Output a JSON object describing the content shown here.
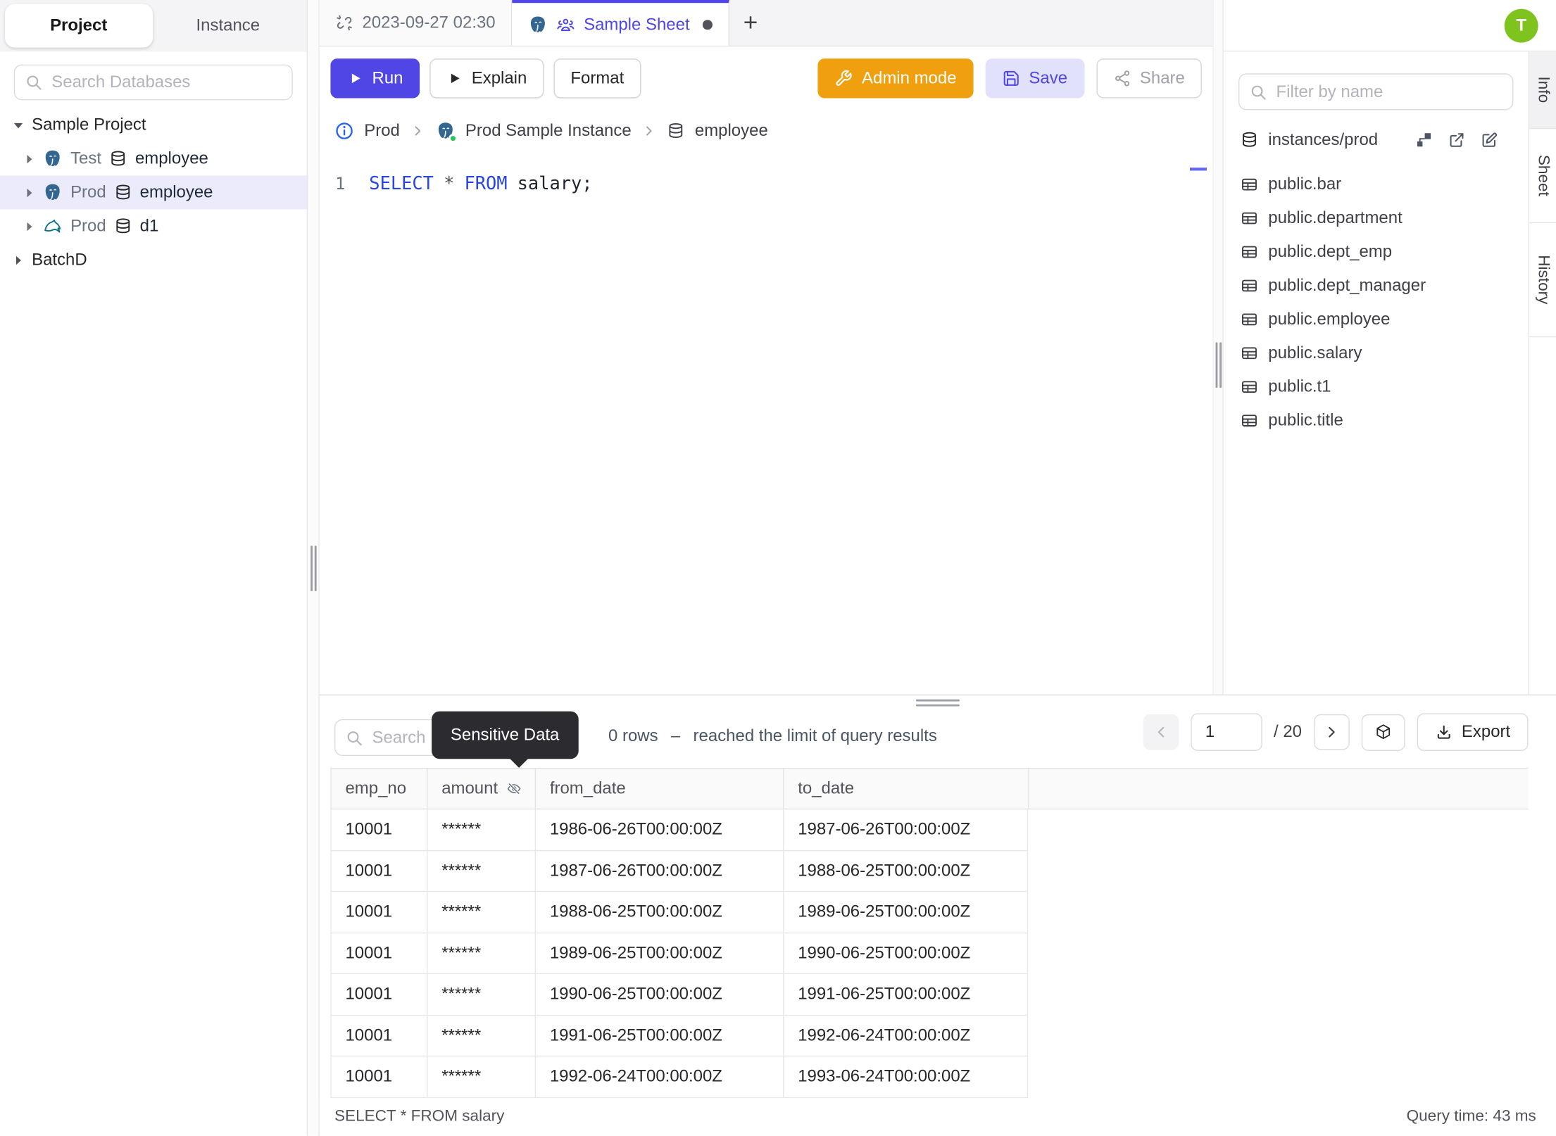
{
  "sidebar": {
    "tabs": {
      "project": "Project",
      "instance": "Instance"
    },
    "search_placeholder": "Search Databases",
    "tree": {
      "project_label": "Sample Project",
      "items": [
        {
          "env": "Test",
          "db": "employee",
          "engine": "postgres"
        },
        {
          "env": "Prod",
          "db": "employee",
          "engine": "postgres",
          "selected": true
        },
        {
          "env": "Prod",
          "db": "d1",
          "engine": "mysql"
        }
      ],
      "batch_label": "BatchD"
    }
  },
  "tabbar": {
    "tab1": "2023-09-27 02:30",
    "tab2": "Sample Sheet",
    "new_tab": "+"
  },
  "toolbar": {
    "run": "Run",
    "explain": "Explain",
    "format": "Format",
    "admin": "Admin mode",
    "save": "Save",
    "share": "Share"
  },
  "breadcrumb": {
    "env": "Prod",
    "instance": "Prod Sample Instance",
    "db": "employee"
  },
  "editor": {
    "line_number": "1",
    "keyword1": "SELECT",
    "star": "*",
    "keyword2": "FROM",
    "rest": "salary;"
  },
  "avatar": "T",
  "schema_panel": {
    "filter_placeholder": "Filter by name",
    "source": "instances/prod",
    "tables": [
      "public.bar",
      "public.department",
      "public.dept_emp",
      "public.dept_manager",
      "public.employee",
      "public.salary",
      "public.t1",
      "public.title"
    ]
  },
  "side_tabs": [
    "Info",
    "Sheet",
    "History"
  ],
  "results": {
    "search_placeholder": "Search",
    "tooltip": "Sensitive Data",
    "rows_count": "0 rows",
    "separator": "–",
    "limit_note": "reached the limit of query results",
    "page": "1",
    "page_total": "/ 20",
    "export_label": "Export",
    "table": {
      "headers": [
        "emp_no",
        "amount",
        "from_date",
        "to_date"
      ],
      "rows": [
        [
          "10001",
          "******",
          "1986-06-26T00:00:00Z",
          "1987-06-26T00:00:00Z"
        ],
        [
          "10001",
          "******",
          "1987-06-26T00:00:00Z",
          "1988-06-25T00:00:00Z"
        ],
        [
          "10001",
          "******",
          "1988-06-25T00:00:00Z",
          "1989-06-25T00:00:00Z"
        ],
        [
          "10001",
          "******",
          "1989-06-25T00:00:00Z",
          "1990-06-25T00:00:00Z"
        ],
        [
          "10001",
          "******",
          "1990-06-25T00:00:00Z",
          "1991-06-25T00:00:00Z"
        ],
        [
          "10001",
          "******",
          "1991-06-25T00:00:00Z",
          "1992-06-24T00:00:00Z"
        ],
        [
          "10001",
          "******",
          "1992-06-24T00:00:00Z",
          "1993-06-24T00:00:00Z"
        ]
      ]
    },
    "statement": "SELECT * FROM salary",
    "query_time": "Query time: 43 ms"
  },
  "colors": {
    "accent": "#4f46e5",
    "admin_orange": "#f0a00f",
    "keyword_blue": "#2945e2",
    "avatar_green": "#7fc41e",
    "selected_row": "#ebebfc",
    "tooltip_bg": "#2c2c30",
    "status_green_dot": "#22c55e"
  }
}
